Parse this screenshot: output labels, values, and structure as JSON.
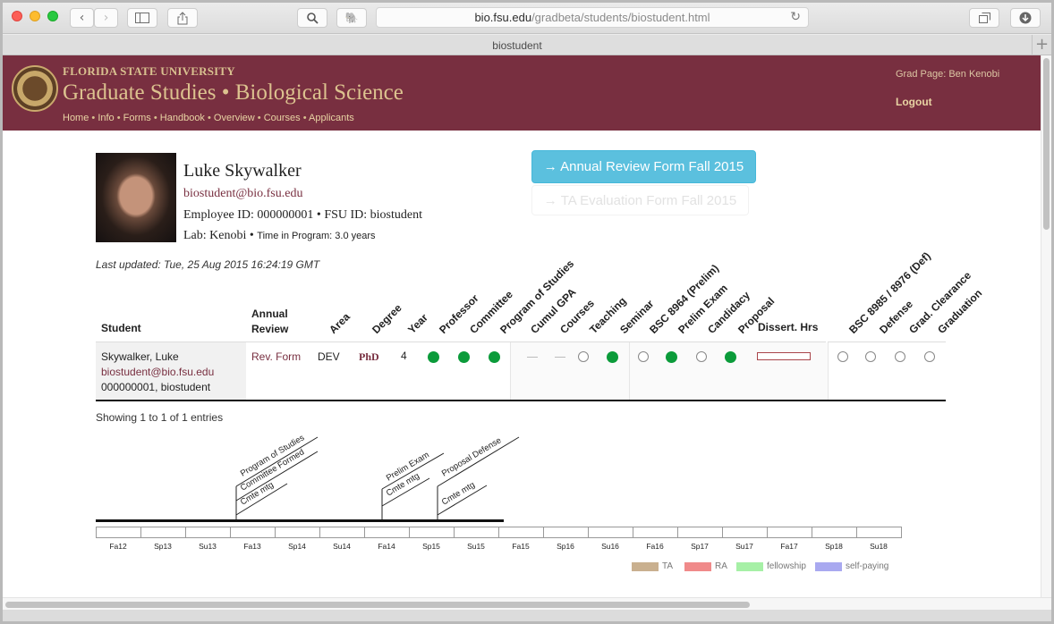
{
  "browser": {
    "url_host": "bio.fsu.edu",
    "url_path": "/gradbeta/students/biostudent.html",
    "tab_title": "biostudent"
  },
  "header": {
    "university": "FLORIDA STATE UNIVERSITY",
    "title": "Graduate Studies • Biological Science",
    "nav": [
      "Home",
      "Info",
      "Forms",
      "Handbook",
      "Overview",
      "Courses",
      "Applicants"
    ],
    "grad_page": "Grad Page: Ben Kenobi",
    "logout": "Logout"
  },
  "student": {
    "name": "Luke Skywalker",
    "email": "biostudent@bio.fsu.edu",
    "ids": "Employee ID: 000000001 • FSU ID: biostudent",
    "lab": "Lab: Kenobi •",
    "time_in_program": "Time in Program: 3.0 years"
  },
  "actions": {
    "annual_review": "→ Annual Review Form Fall 2015",
    "ta_evaluation": "→ TA Evaluation Form Fall 2015"
  },
  "last_updated": "Last updated: Tue, 25 Aug 2015 16:24:19 GMT",
  "table": {
    "headers": {
      "student": "Student",
      "annual_review": "Annual Review",
      "dissert_hrs": "Dissert. Hrs",
      "rotated": [
        "Area",
        "Degree",
        "Year",
        "Professor",
        "Committee",
        "Program of Studies",
        "Cumul GPA",
        "Courses",
        "Teaching",
        "Seminar",
        "BSC 8964 (Prelim)",
        "Prelim Exam",
        "Candidacy",
        "Proposal",
        "BSC 8985 / 8976 (Def)",
        "Defense",
        "Grad. Clearance",
        "Graduation"
      ]
    },
    "row": {
      "name": "Skywalker, Luke",
      "email": "biostudent@bio.fsu.edu",
      "ids": "000000001, biostudent",
      "review_link": "Rev. Form",
      "area": "DEV",
      "degree": "PhD",
      "year": "4"
    },
    "showing": "Showing 1 to 1 of 1 entries"
  },
  "timeline": {
    "terms": [
      "Fa12",
      "Sp13",
      "Su13",
      "Fa13",
      "Sp14",
      "Su14",
      "Fa14",
      "Sp15",
      "Su15",
      "Fa15",
      "Sp16",
      "Su16",
      "Fa16",
      "Sp17",
      "Su17",
      "Fa17",
      "Sp18",
      "Su18"
    ],
    "events": [
      "Program of Studies",
      "Committee Formed",
      "Cmte mtg",
      "Prelim Exam",
      "Cmte mtg",
      "Proposal Defense",
      "Cmte mtg"
    ],
    "legend": [
      {
        "label": "TA",
        "color": "#c9b08f"
      },
      {
        "label": "RA",
        "color": "#f08a8a"
      },
      {
        "label": "fellowship",
        "color": "#a6f0a6"
      },
      {
        "label": "self-paying",
        "color": "#a9a9f0"
      }
    ]
  },
  "colors": {
    "garnet": "#782f40",
    "gold": "#dcc28f",
    "done_green": "#0b9b3a",
    "info_blue": "#5bc0de"
  }
}
